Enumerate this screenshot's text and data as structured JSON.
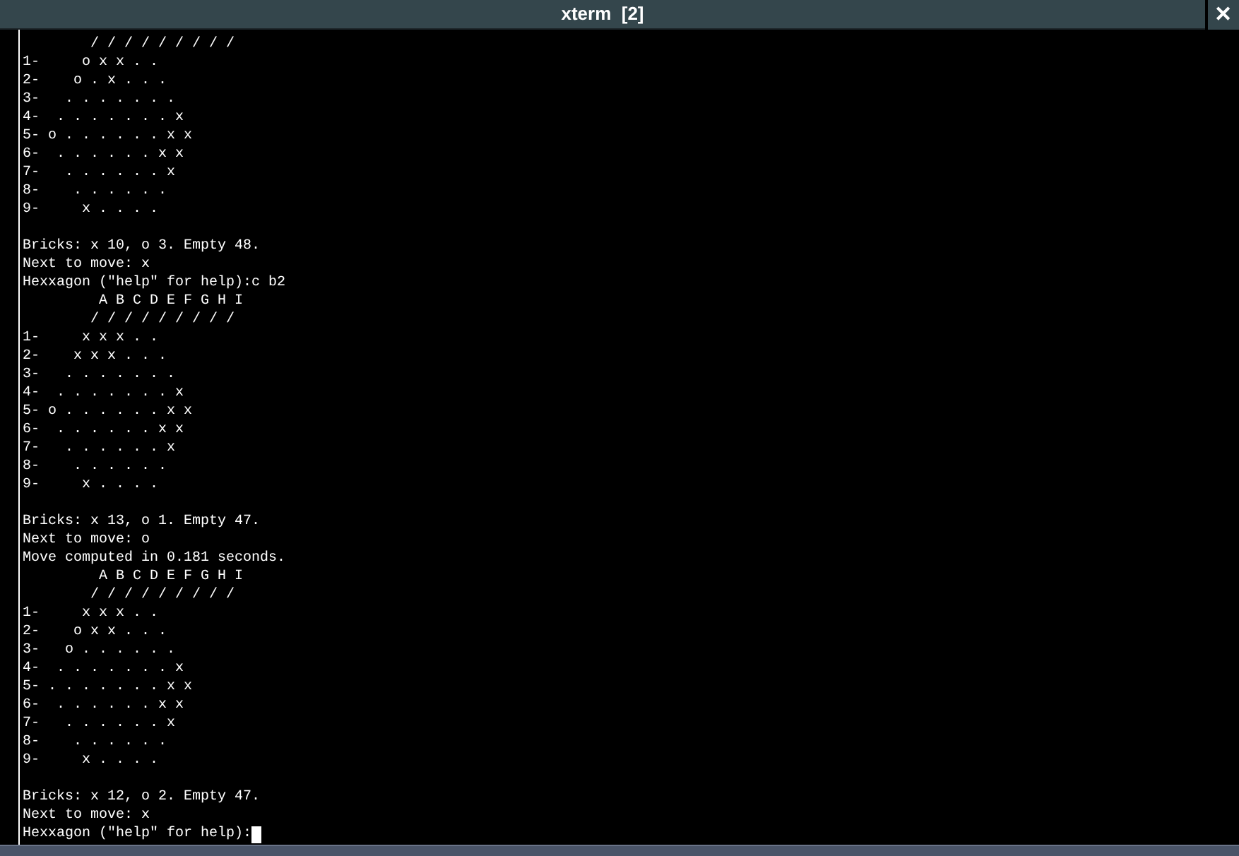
{
  "window": {
    "title": "xterm  [2]",
    "close": "✕"
  },
  "terminal": {
    "blocks": [
      {
        "lines": [
          "        / / / / / / / / /",
          "1-     o x x . .",
          "2-    o . x . . .",
          "3-   . . . . . . .",
          "4-  . . . . . . . x",
          "5- o . . . . . . x x",
          "6-  . . . . . . x x",
          "7-   . . . . . . x",
          "8-    . . . . . .",
          "9-     x . . . ."
        ]
      },
      {
        "lines": [
          "Bricks: x 10, o 3. Empty 48.",
          "Next to move: x",
          "Hexxagon (\"help\" for help):c b2",
          "         A B C D E F G H I",
          "        / / / / / / / / /",
          "1-     x x x . .",
          "2-    x x x . . .",
          "3-   . . . . . . .",
          "4-  . . . . . . . x",
          "5- o . . . . . . x x",
          "6-  . . . . . . x x",
          "7-   . . . . . . x",
          "8-    . . . . . .",
          "9-     x . . . ."
        ]
      },
      {
        "lines": [
          "Bricks: x 13, o 1. Empty 47.",
          "Next to move: o",
          "Move computed in 0.181 seconds.",
          "         A B C D E F G H I",
          "        / / / / / / / / /",
          "1-     x x x . .",
          "2-    o x x . . .",
          "3-   o . . . . . .",
          "4-  . . . . . . . x",
          "5- . . . . . . . x x",
          "6-  . . . . . . x x",
          "7-   . . . . . . x",
          "8-    . . . . . .",
          "9-     x . . . ."
        ]
      },
      {
        "lines": [
          "Bricks: x 12, o 2. Empty 47.",
          "Next to move: x",
          "Hexxagon (\"help\" for help):"
        ]
      }
    ],
    "cursor": true
  }
}
